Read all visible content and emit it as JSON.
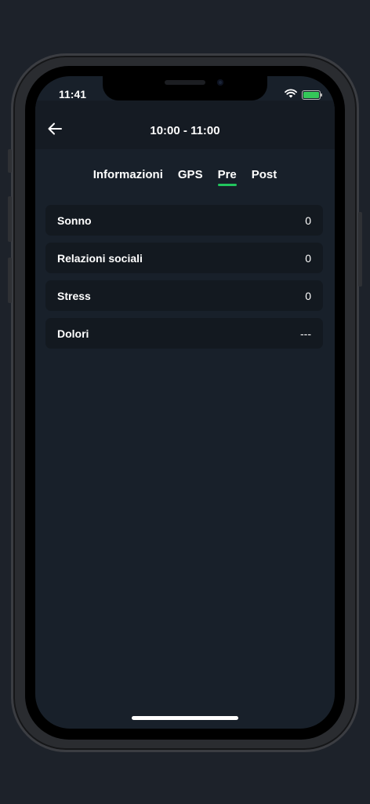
{
  "status_bar": {
    "time": "11:41",
    "icons": [
      "wifi-icon",
      "battery-charging-icon"
    ],
    "battery_color": "#34c759"
  },
  "header": {
    "back_icon": "arrow-left-icon",
    "title": "10:00 - 11:00"
  },
  "tabs": [
    {
      "label": "Informazioni",
      "active": false
    },
    {
      "label": "GPS",
      "active": false
    },
    {
      "label": "Pre",
      "active": true
    },
    {
      "label": "Post",
      "active": false
    }
  ],
  "accent_color": "#22c55e",
  "rows": [
    {
      "label": "Sonno",
      "value": "0"
    },
    {
      "label": "Relazioni sociali",
      "value": "0"
    },
    {
      "label": "Stress",
      "value": "0"
    },
    {
      "label": "Dolori",
      "value": "---"
    }
  ]
}
